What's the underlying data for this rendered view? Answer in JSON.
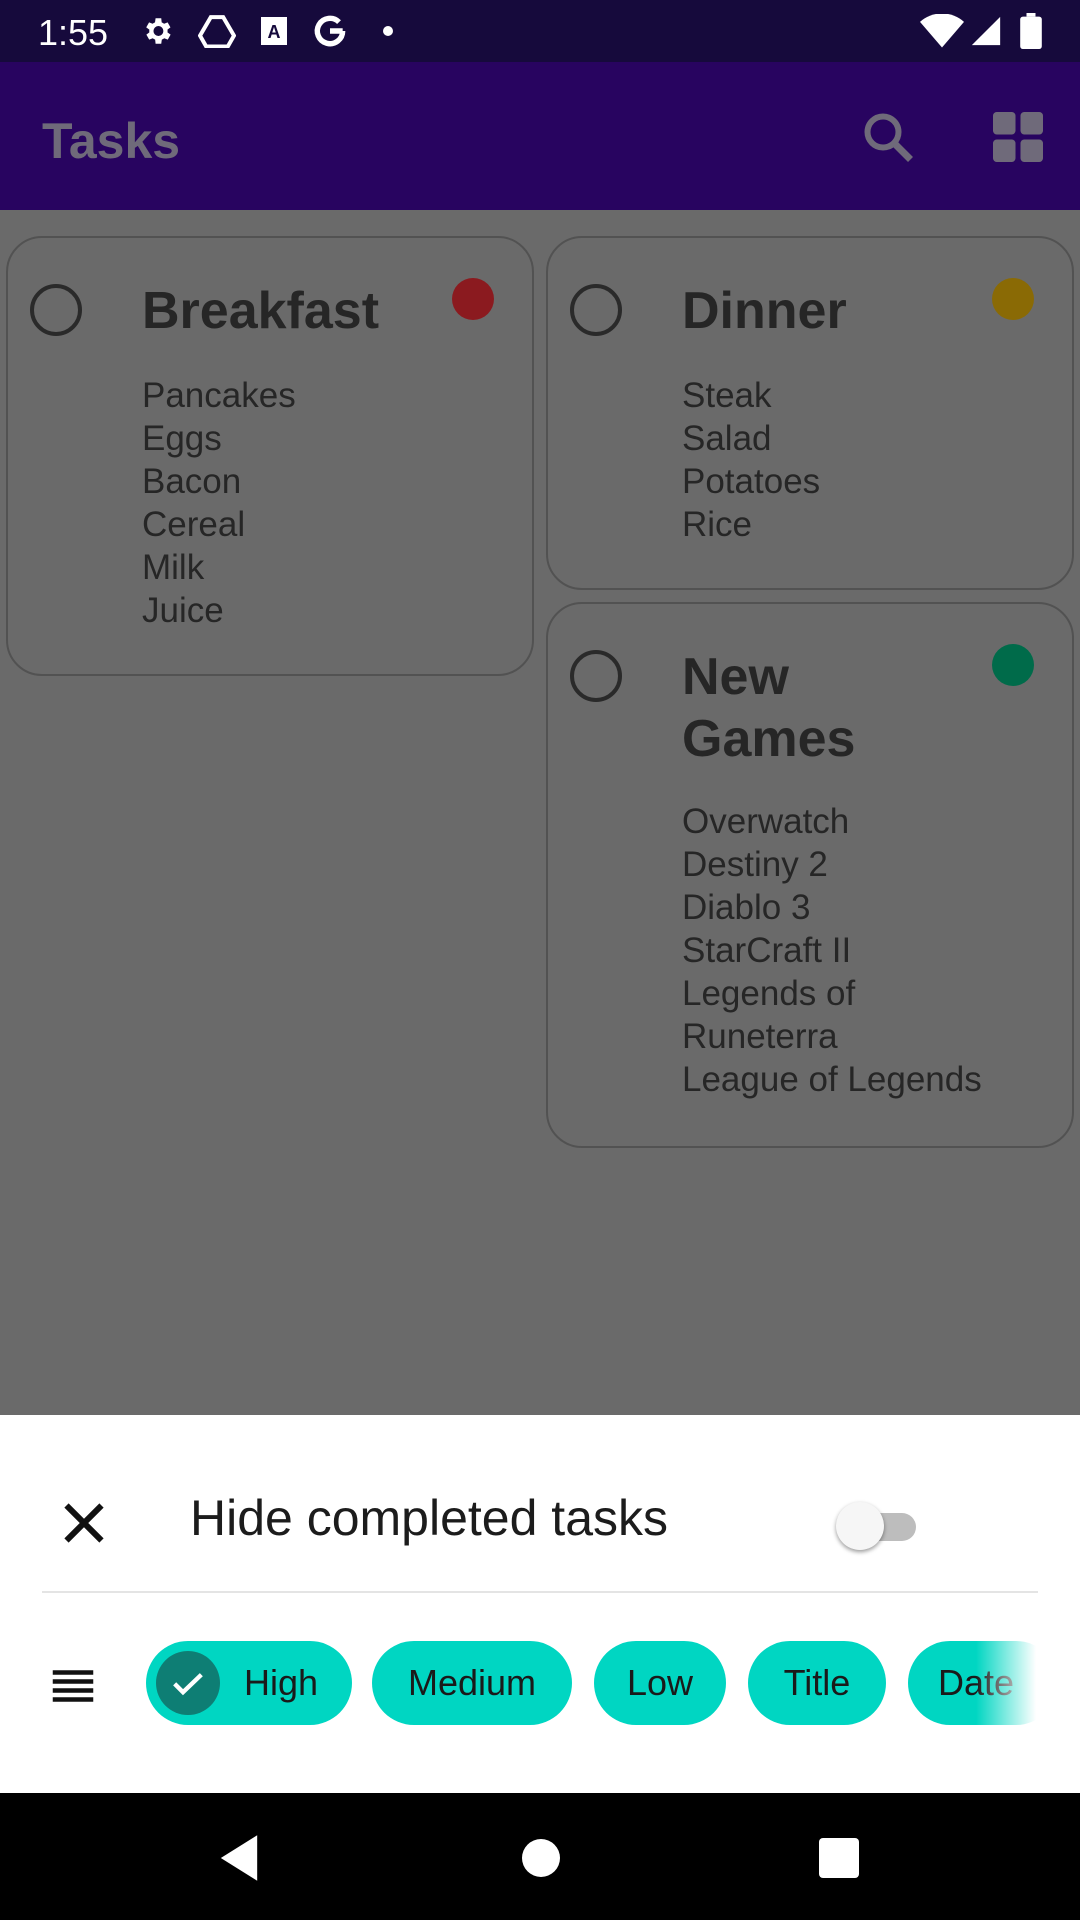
{
  "status_bar": {
    "time": "1:55",
    "icons": [
      "gear-icon",
      "drive-icon",
      "text-a-icon",
      "google-icon",
      "dot-icon",
      "wifi-icon",
      "signal-icon",
      "battery-icon"
    ]
  },
  "app_bar": {
    "title": "Tasks",
    "actions": [
      "search-icon",
      "grid-view-icon"
    ]
  },
  "tasks": [
    {
      "title": "Breakfast",
      "priority_color": "#8b1a1f",
      "items": [
        "Pancakes",
        "Eggs",
        "Bacon",
        "Cereal",
        "Milk",
        "Juice"
      ]
    },
    {
      "title": "Dinner",
      "priority_color": "#8a6a05",
      "items": [
        "Steak",
        "Salad",
        "Potatoes",
        "Rice"
      ]
    },
    {
      "title": "New Games",
      "priority_color": "#006b4a",
      "items": [
        "Overwatch",
        "Destiny 2",
        "Diablo 3",
        "StarCraft II",
        "Legends of Runeterra",
        "League of Legends"
      ]
    }
  ],
  "bottom_sheet": {
    "hide_completed_label": "Hide completed tasks",
    "hide_completed_on": false,
    "chips": [
      {
        "label": "High",
        "selected": true
      },
      {
        "label": "Medium",
        "selected": false
      },
      {
        "label": "Low",
        "selected": false
      },
      {
        "label": "Title",
        "selected": false
      },
      {
        "label": "Date",
        "selected": false
      }
    ]
  },
  "colors": {
    "accent": "#00d6c2",
    "app_bar": "#280460",
    "status_bar": "#160a3c"
  }
}
